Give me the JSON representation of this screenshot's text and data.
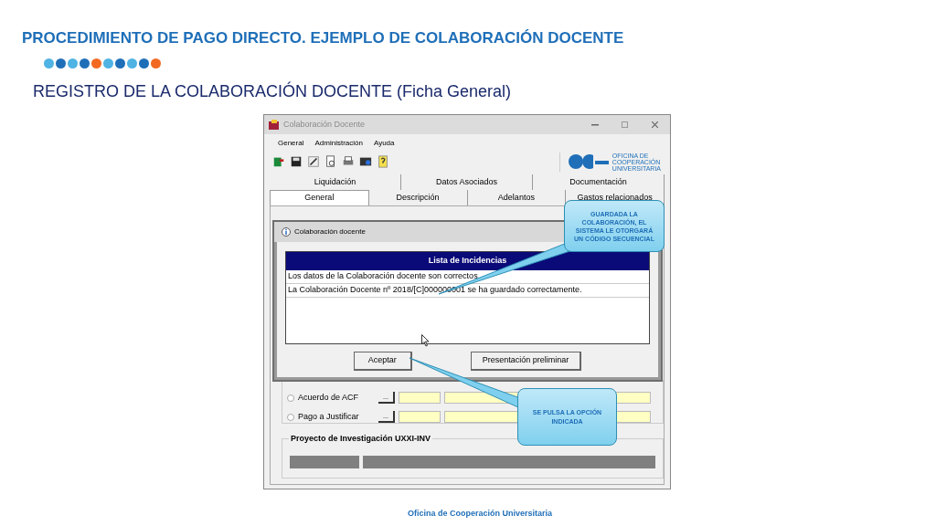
{
  "slide": {
    "title": "PROCEDIMIENTO DE PAGO DIRECTO. EJEMPLO DE COLABORACIÓN DOCENTE",
    "dots": [
      {
        "color": "#4fb3e3"
      },
      {
        "color": "#1f6fb8"
      },
      {
        "color": "#4fb3e3"
      },
      {
        "color": "#1f6fb8"
      },
      {
        "color": "#f26a21"
      },
      {
        "color": "#4fb3e3"
      },
      {
        "color": "#1f6fb8"
      },
      {
        "color": "#4fb3e3"
      },
      {
        "color": "#1f6fb8"
      },
      {
        "color": "#f26a21"
      }
    ],
    "subtitle": "REGISTRO DE LA COLABORACIÓN DOCENTE (Ficha General)",
    "footer": "Oficina de Cooperación Universitaria"
  },
  "window": {
    "title": "Colaboración Docente",
    "menu": [
      "General",
      "Administración",
      "Ayuda"
    ],
    "logo_lines": [
      "OFICINA DE",
      "COOPERACIÓN",
      "UNIVERSITARIA"
    ],
    "tab_rows": [
      [
        {
          "label": "Liquidación",
          "selected": false
        },
        {
          "label": "Datos Asociados",
          "selected": false
        },
        {
          "label": "Documentación",
          "selected": false
        }
      ],
      [
        {
          "label": "General",
          "selected": true
        },
        {
          "label": "Descripción",
          "selected": false
        },
        {
          "label": "Adelantos",
          "selected": false
        },
        {
          "label": "Gastos relacionados",
          "selected": false
        }
      ]
    ],
    "radios": [
      {
        "label": "Acuerdo de ACF",
        "checked": false,
        "browse": "..."
      },
      {
        "label": "Pago a Justificar",
        "checked": false,
        "browse": "..."
      }
    ],
    "group_title": "Proyecto de Investigación UXXI-INV"
  },
  "dialog": {
    "title": "Colaboración docente",
    "list_header": "Lista de Incidencias",
    "rows": [
      "Los datos de la Colaboración docente son correctos.",
      "La Colaboración Docente nº 2018/[C]000000001 se ha guardado correctamente."
    ],
    "buttons": [
      "Aceptar",
      "Presentación preliminar"
    ]
  },
  "callouts": [
    "GUARDADA LA COLABORACIÓN, EL SISTEMA LE OTORGARÁ UN CÓDIGO SECUENCIAL",
    "SE PULSA LA OPCIÓN INDICADA"
  ]
}
